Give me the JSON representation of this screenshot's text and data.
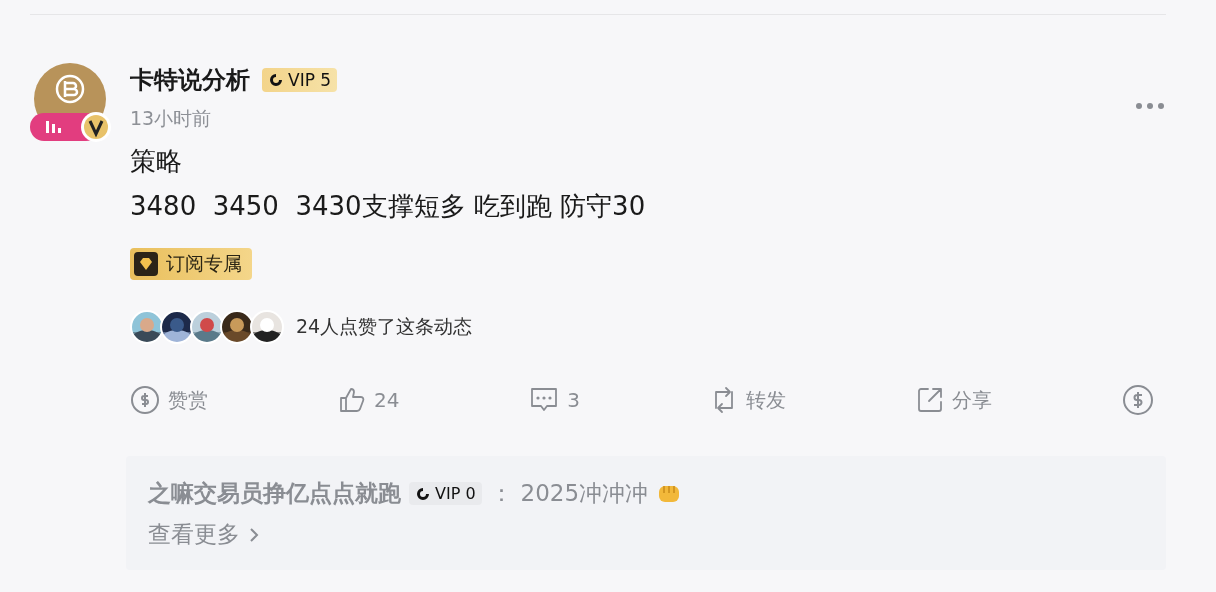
{
  "post": {
    "author": "卡特说分析",
    "vip_badge": "VIP 5",
    "time": "13小时前",
    "content_title": "策略",
    "content_body": "3480  3450  3430支撑短多 吃到跑 防守30",
    "tag": "订阅专属",
    "likes_summary": "24人点赞了这条动态",
    "actions": [
      {
        "kind": "tip",
        "label": "赞赏"
      },
      {
        "kind": "like",
        "label": "24"
      },
      {
        "kind": "comment",
        "label": "3"
      },
      {
        "kind": "repost",
        "label": "转发"
      },
      {
        "kind": "share",
        "label": "分享"
      },
      {
        "kind": "coin"
      }
    ]
  },
  "comments": [
    {
      "user": "之嘛交易员挣亿点点就跑",
      "vip_badge": "VIP 0",
      "separator": "：",
      "text": "2025冲冲冲"
    }
  ],
  "more_link": "查看更多"
}
